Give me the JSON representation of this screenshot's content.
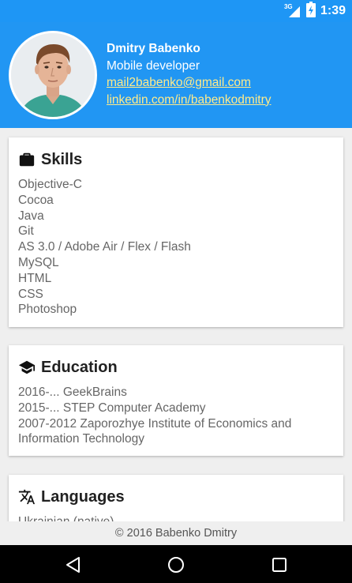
{
  "status_bar": {
    "network_label": "3G",
    "time": "1:39",
    "icons": [
      "signal-icon",
      "battery-charging-icon"
    ]
  },
  "profile": {
    "name": "Dmitry Babenko",
    "role": "Mobile developer",
    "email": "mail2babenko@gmail.com",
    "linkedin": "linkedin.com/in/babenkodmitry",
    "avatar": "profile-photo",
    "accent_color": "#2196f3",
    "link_color": "#ffeb8a"
  },
  "sections": {
    "skills": {
      "title": "Skills",
      "icon": "briefcase-icon",
      "items": [
        "Objective-C",
        "Cocoa",
        "Java",
        "Git",
        "AS 3.0 / Adobe Air / Flex / Flash",
        "MySQL",
        "HTML",
        "CSS",
        "Photoshop"
      ]
    },
    "education": {
      "title": "Education",
      "icon": "graduation-cap-icon",
      "items": [
        "2016-... GeekBrains",
        "2015-... STEP Computer Academy",
        "2007-2012 Zaporozhye Institute of Economics and Information Technology"
      ]
    },
    "languages": {
      "title": "Languages",
      "icon": "translate-icon",
      "items": [
        "Ukrainian (native)"
      ]
    }
  },
  "footer": {
    "text": "© 2016 Babenko Dmitry"
  },
  "nav_bar": {
    "buttons": [
      "back-icon",
      "home-icon",
      "recents-icon"
    ]
  }
}
